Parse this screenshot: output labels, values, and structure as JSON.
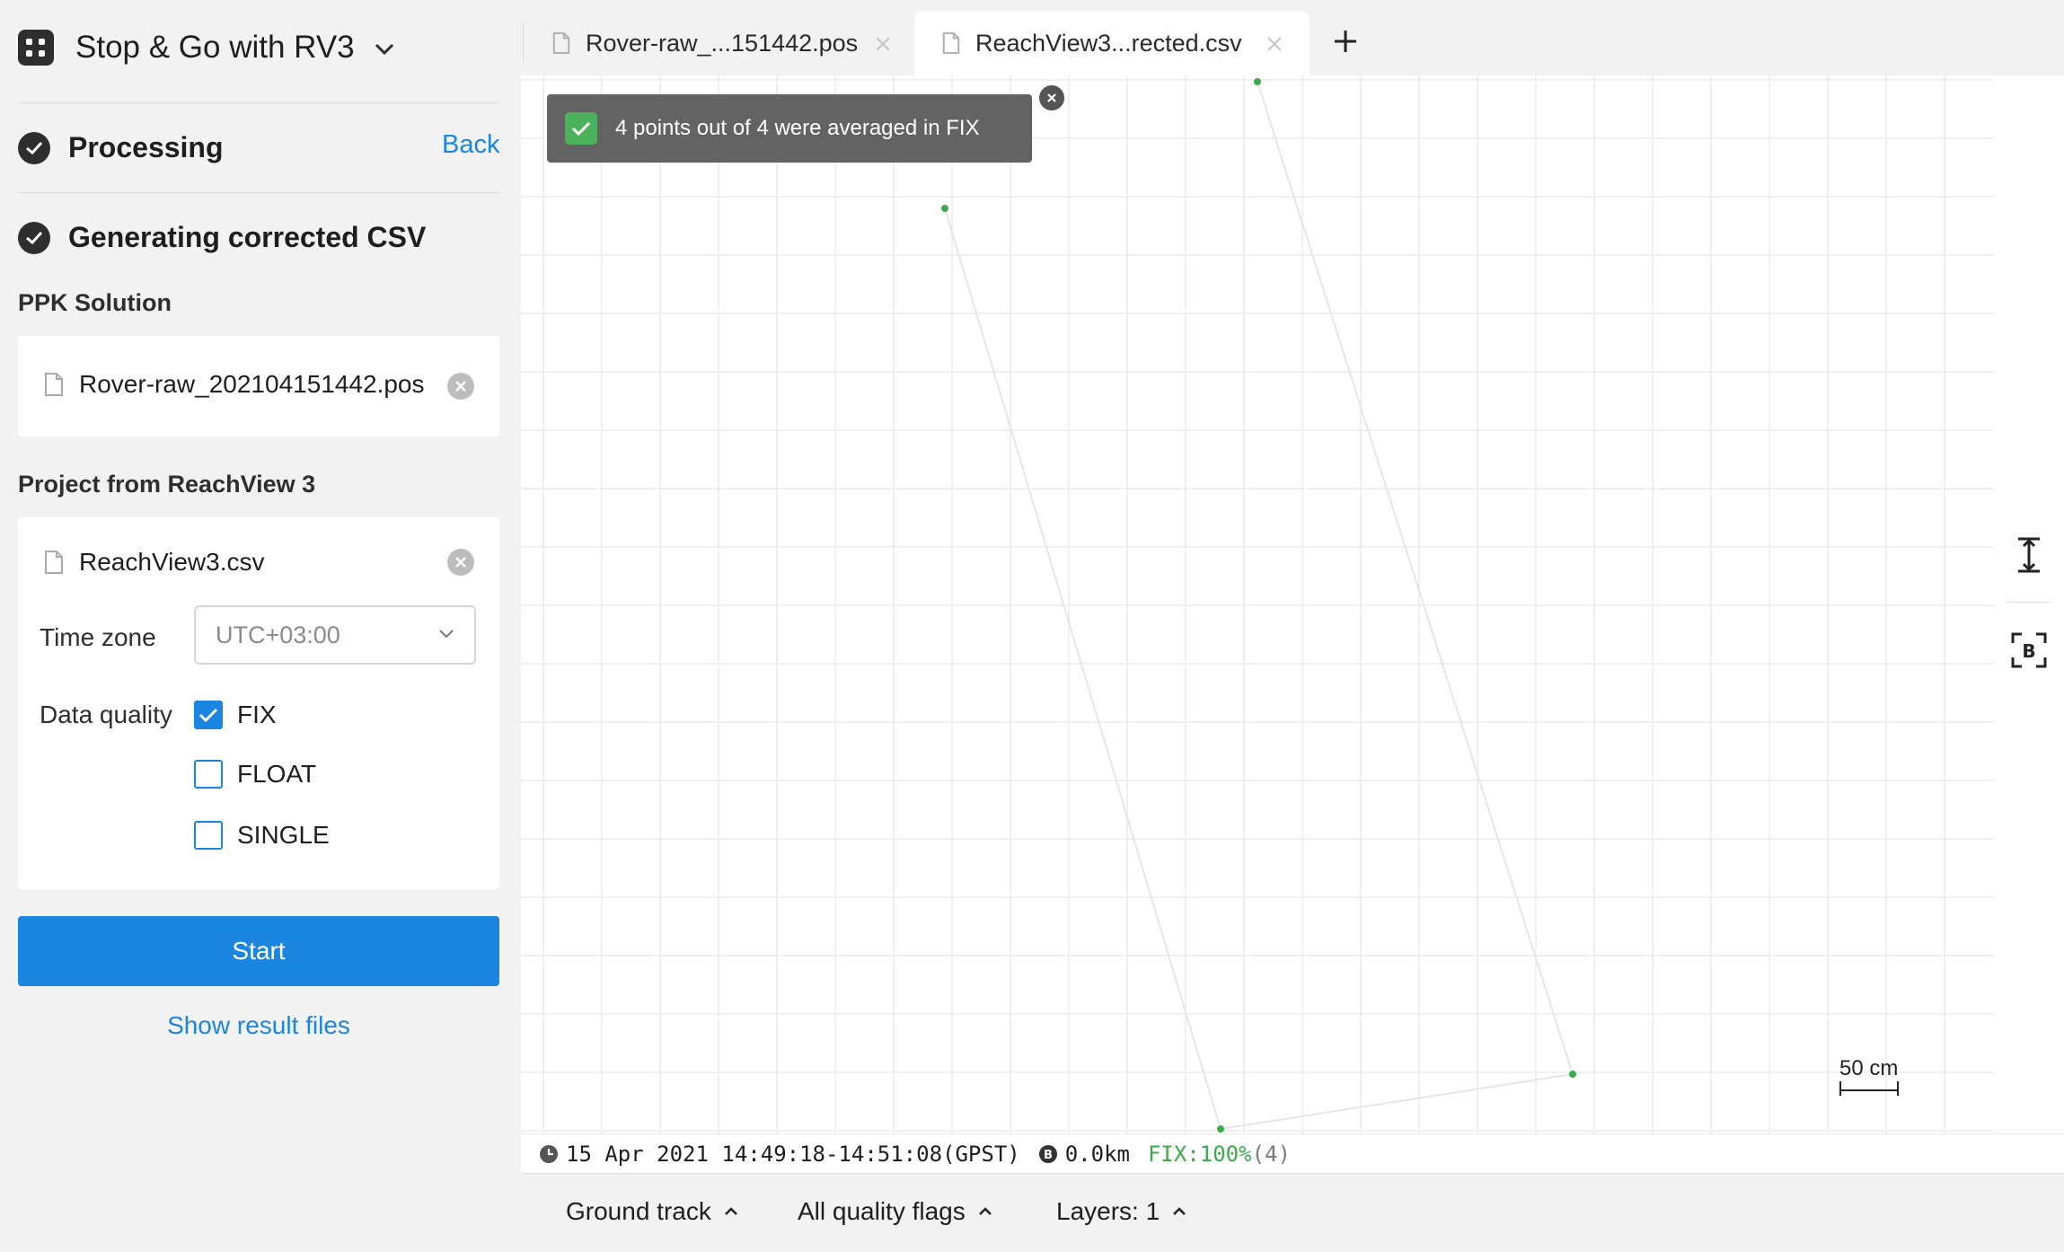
{
  "app": {
    "title": "Stop & Go with RV3"
  },
  "steps": {
    "processing": {
      "label": "Processing",
      "back_label": "Back"
    },
    "generating": {
      "label": "Generating corrected CSV"
    }
  },
  "ppk": {
    "section_title": "PPK Solution",
    "file_name": "Rover-raw_202104151442.pos"
  },
  "project": {
    "section_title": "Project from ReachView 3",
    "file_name": "ReachView3.csv",
    "timezone_label": "Time zone",
    "timezone_value": "UTC+03:00",
    "quality_label": "Data quality",
    "quality_options": [
      {
        "label": "FIX",
        "checked": true
      },
      {
        "label": "FLOAT",
        "checked": false
      },
      {
        "label": "SINGLE",
        "checked": false
      }
    ]
  },
  "actions": {
    "start_label": "Start",
    "show_results_label": "Show result files"
  },
  "tabs": [
    {
      "label": "Rover-raw_...151442.pos",
      "active": false
    },
    {
      "label": "ReachView3...rected.csv",
      "active": true
    }
  ],
  "toast": {
    "text": "4 points out of 4 were averaged in FIX"
  },
  "map": {
    "scale_label": "50 cm",
    "track_color": "#e6e6e6",
    "point_color": "#3cab4b"
  },
  "status": {
    "time_range": "15 Apr 2021 14:49:18-14:51:08(GPST)",
    "distance": "0.0km",
    "fix": "FIX:100%",
    "count": "(4)"
  },
  "bottom": {
    "ground_track": "Ground track",
    "quality_flags": "All quality flags",
    "layers": "Layers: 1"
  },
  "colors": {
    "accent": "#1a86e0",
    "fix_green": "#3cab4b",
    "toast_bg": "#636363"
  },
  "icons": [
    "app-grid-icon",
    "chevron-down-icon",
    "check-circle-icon",
    "file-icon",
    "clear-icon",
    "close-icon",
    "plus-icon",
    "zoom-vertical-icon",
    "base-icon",
    "clock-icon",
    "chevron-up-icon"
  ]
}
